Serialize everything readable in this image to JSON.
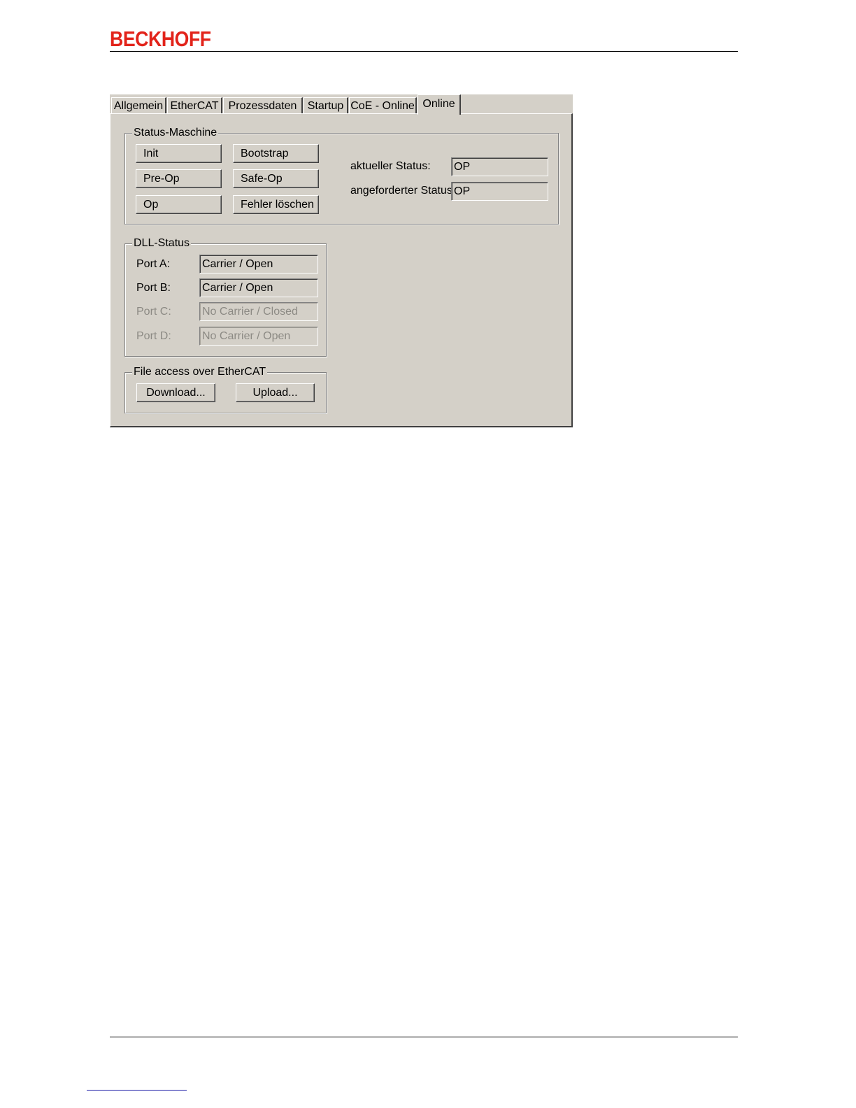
{
  "document": {
    "brand": "BECKHOFF"
  },
  "dialog": {
    "tabs": [
      {
        "label": "Allgemein"
      },
      {
        "label": "EtherCAT"
      },
      {
        "label": "Prozessdaten"
      },
      {
        "label": "Startup"
      },
      {
        "label": "CoE - Online"
      },
      {
        "label": "Online"
      }
    ],
    "active_tab": "Online",
    "status_machine": {
      "title": "Status-Maschine",
      "buttons": {
        "init": "Init",
        "bootstrap": "Bootstrap",
        "pre_op": "Pre-Op",
        "safe_op": "Safe-Op",
        "op": "Op",
        "clear_errors": "Fehler löschen"
      },
      "current_status_label": "aktueller Status:",
      "current_status_value": "OP",
      "requested_status_label": "angeforderter Status:",
      "requested_status_value": "OP"
    },
    "dll_status": {
      "title": "DLL-Status",
      "ports": [
        {
          "label": "Port A:",
          "value": "Carrier / Open",
          "enabled": true
        },
        {
          "label": "Port B:",
          "value": "Carrier / Open",
          "enabled": true
        },
        {
          "label": "Port C:",
          "value": "No Carrier / Closed",
          "enabled": false
        },
        {
          "label": "Port D:",
          "value": "No Carrier / Open",
          "enabled": false
        }
      ]
    },
    "file_access": {
      "title": "File access over EtherCAT",
      "download_label": "Download...",
      "upload_label": "Upload..."
    }
  },
  "colors": {
    "brand_red": "#e2231a",
    "dialog_face": "#d4d0c8",
    "disabled_text": "#8c8a84",
    "footer_link_rule": "#1a1aa6"
  }
}
